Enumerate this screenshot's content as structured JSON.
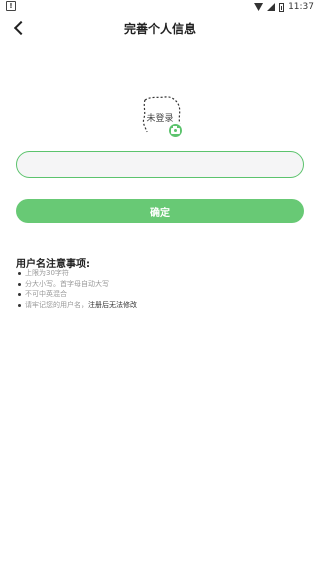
{
  "status_bar": {
    "warning_icon_text": "!",
    "time": "11:37"
  },
  "header": {
    "title": "完善个人信息"
  },
  "avatar": {
    "label": "未登录"
  },
  "username_input": {
    "value": "",
    "placeholder": ""
  },
  "confirm_button": {
    "label": "确定"
  },
  "notes": {
    "title": "用户名注意事项:",
    "items": [
      {
        "text": "上限为30字符",
        "emphasis": ""
      },
      {
        "text": "分大小写。首字母自动大写",
        "emphasis": ""
      },
      {
        "text": "不可中英混合",
        "emphasis": ""
      },
      {
        "text": "请牢记您的用户名，",
        "emphasis": "注册后无法修改"
      }
    ]
  },
  "colors": {
    "accent": "#5cc36d",
    "button": "#68c975",
    "input_bg": "#f5f5f6"
  }
}
